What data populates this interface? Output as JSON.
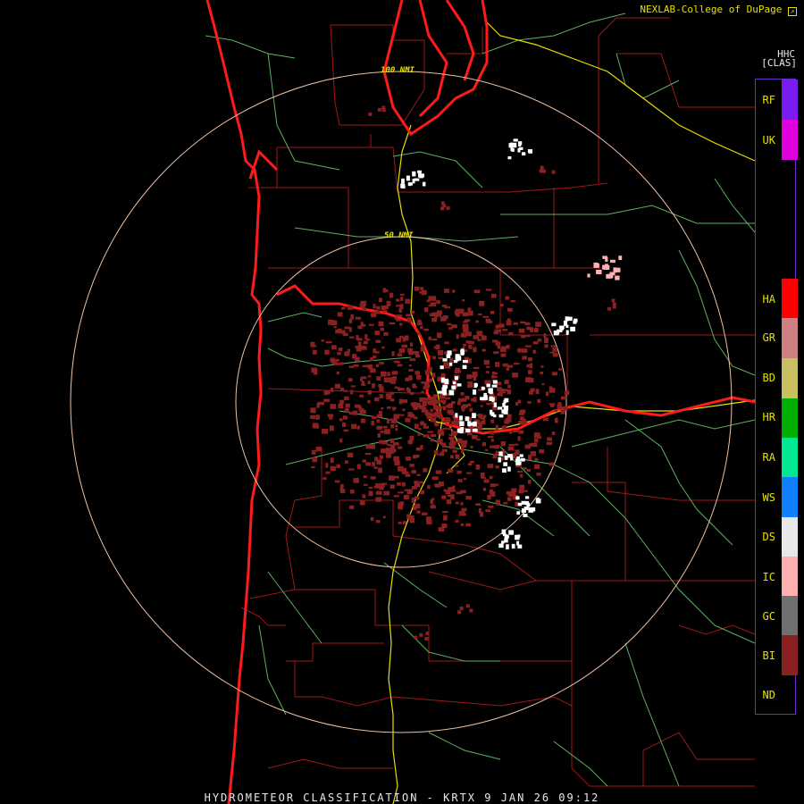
{
  "credit": "NEXLAB-College of DuPage",
  "credit_icon": "arrow-icon",
  "product_code": "HHC",
  "product_tag": "[CLAS]",
  "footer": "HYDROMETEOR CLASSIFICATION - KRTX 9 JAN 26 09:12",
  "ring_labels": {
    "inner": "50 NMI",
    "outer": "100 NMI"
  },
  "legend": [
    {
      "code": "RF",
      "color": "#7a1cf0"
    },
    {
      "code": "UK",
      "color": "#e000e0"
    },
    {
      "code": "HA",
      "color": "#ff0000"
    },
    {
      "code": "GR",
      "color": "#d08080"
    },
    {
      "code": "BD",
      "color": "#c8c060"
    },
    {
      "code": "HR",
      "color": "#00b000"
    },
    {
      "code": "RA",
      "color": "#00e890"
    },
    {
      "code": "WS",
      "color": "#1080ff"
    },
    {
      "code": "DS",
      "color": "#e8e8e8"
    },
    {
      "code": "IC",
      "color": "#ffb0b0"
    },
    {
      "code": "GC",
      "color": "#707070"
    },
    {
      "code": "BI",
      "color": "#8a2020"
    },
    {
      "code": "ND",
      "color": "#000000"
    }
  ]
}
